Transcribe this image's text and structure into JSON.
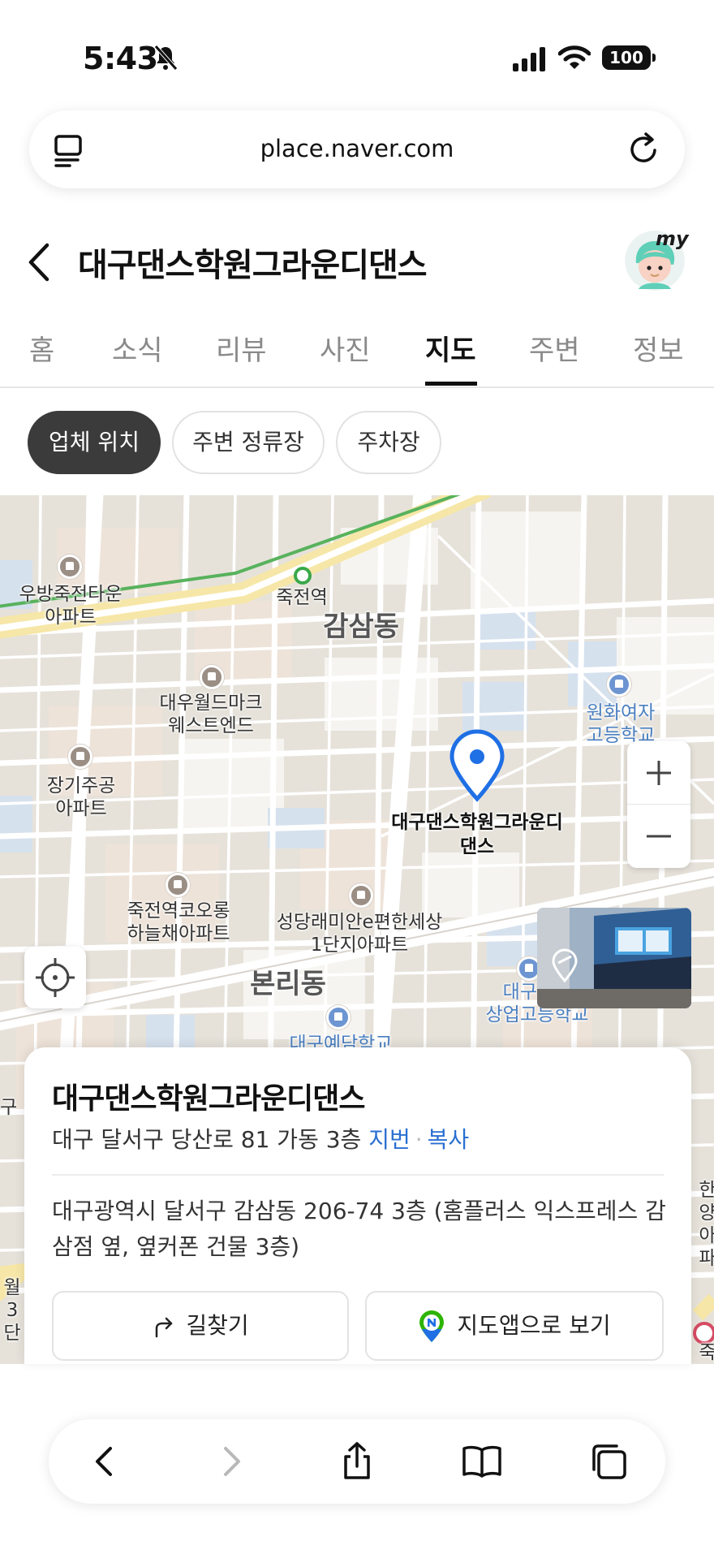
{
  "status_bar": {
    "time": "5:43",
    "battery": "100"
  },
  "browser": {
    "url": "place.naver.com"
  },
  "header": {
    "title": "대구댄스학원그라운디댄스",
    "avatar_badge": "my"
  },
  "tabs": [
    {
      "label": "홈",
      "active": false
    },
    {
      "label": "소식",
      "active": false
    },
    {
      "label": "리뷰",
      "active": false
    },
    {
      "label": "사진",
      "active": false
    },
    {
      "label": "지도",
      "active": true
    },
    {
      "label": "주변",
      "active": false
    },
    {
      "label": "정보",
      "active": false
    }
  ],
  "chips": [
    {
      "label": "업체 위치",
      "active": true
    },
    {
      "label": "주변 정류장",
      "active": false
    },
    {
      "label": "주차장",
      "active": false
    }
  ],
  "map": {
    "labels": {
      "woobang": "우방죽전타운\n아파트",
      "jukjeon_station": "죽전역",
      "gamsam": "감삼동",
      "daewoo": "대우월드마크\n웨스트엔드",
      "wonhwa": "원화여자\n고등학교",
      "janggi": "장기주공\n아파트",
      "place": "대구댄스학원그라운디\n댄스",
      "jukjeon_kolon": "죽전역코오롱\n하늘채아파트",
      "seongdang": "성당래미안e편한세상\n1단지아파트",
      "bonri": "본리동",
      "daegu_commerce": "대구제일\n상업고등학교",
      "daegu_arts": "대구예담학교",
      "edge_ga": "구",
      "edge_wol": "월\n3단",
      "edge_right1": "한양\n아파",
      "edge_right2": "죽현"
    }
  },
  "card": {
    "title": "대구댄스학원그라운디댄스",
    "road_address": "대구 달서구 당산로 81 가동 3층",
    "jibun_link": "지번",
    "copy_link": "복사",
    "jibun_address": "대구광역시 달서구 감삼동 206-74 3층 (홈플러스 익스프레스 감삼점 옆, 옆커폰 건물 3층)",
    "directions_label": "길찾기",
    "map_app_label": "지도앱으로 보기"
  },
  "colors": {
    "accent_blue": "#2a6fd1",
    "pin_blue": "#1f6fe5",
    "chip_active": "#3b3b3b"
  }
}
